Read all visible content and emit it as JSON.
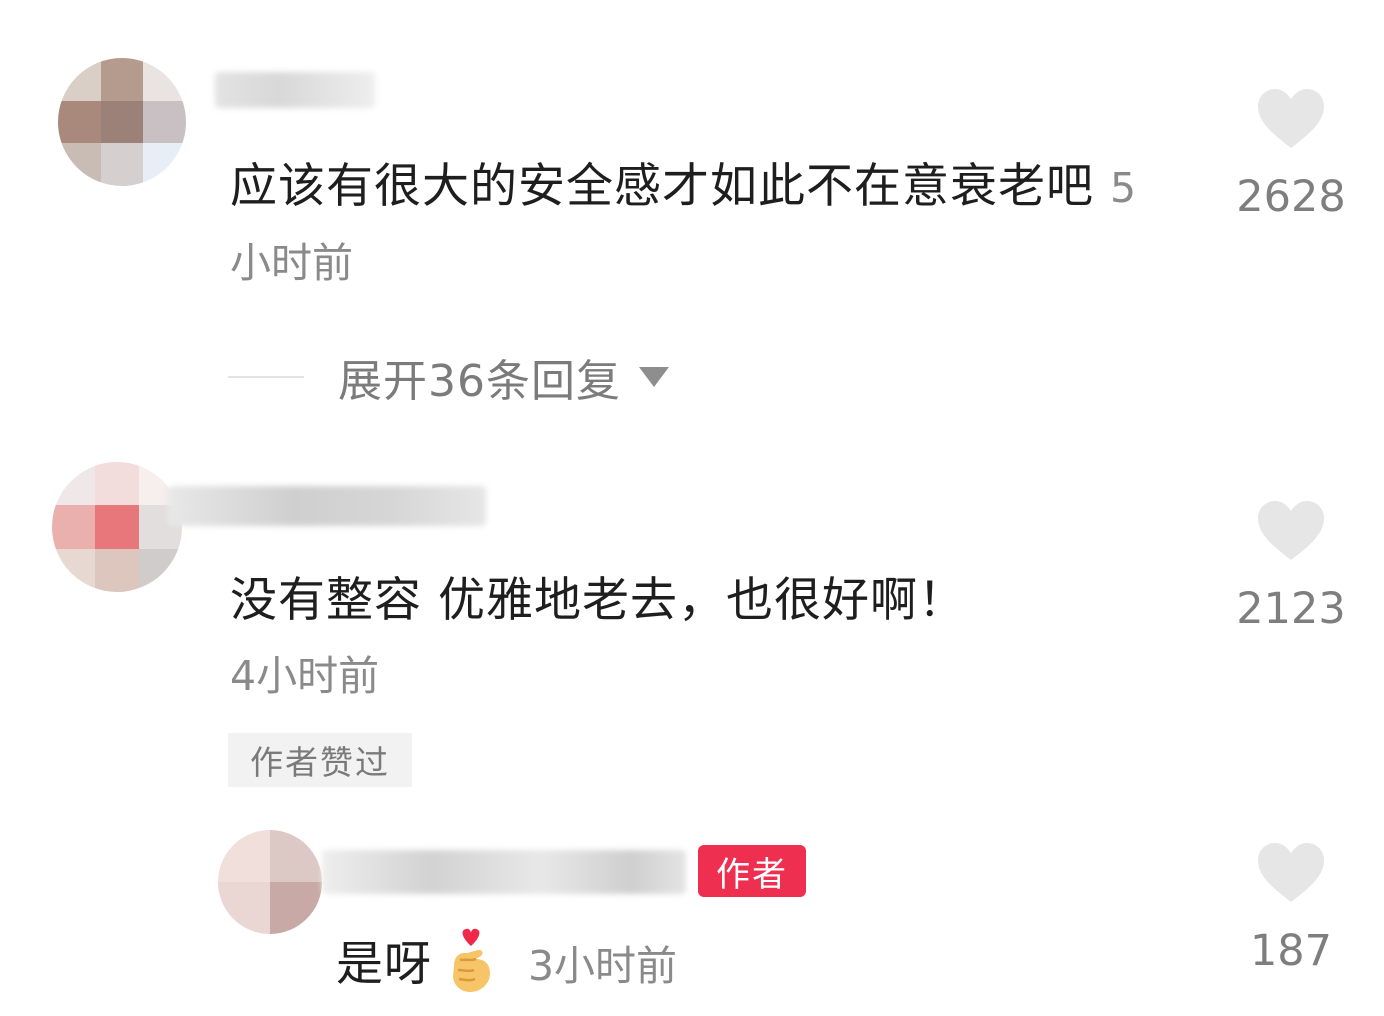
{
  "comments": [
    {
      "text": "应该有很大的安全感才如此不在意衰老吧",
      "time": "5小时前",
      "likes": "2628",
      "expand_replies": "展开36条回复"
    },
    {
      "text": "没有整容 优雅地老去，也很好啊！",
      "time": "4小时前",
      "likes": "2123",
      "badge": "作者赞过"
    }
  ],
  "reply": {
    "author_tag": "作者",
    "text": "是呀",
    "emoji": "finger-heart-icon",
    "time": "3小时前",
    "likes": "187"
  },
  "colors": {
    "author_tag_bg": "#ee2f4f",
    "heart": "#e6e6e6",
    "muted_text": "#8a8a8a"
  }
}
